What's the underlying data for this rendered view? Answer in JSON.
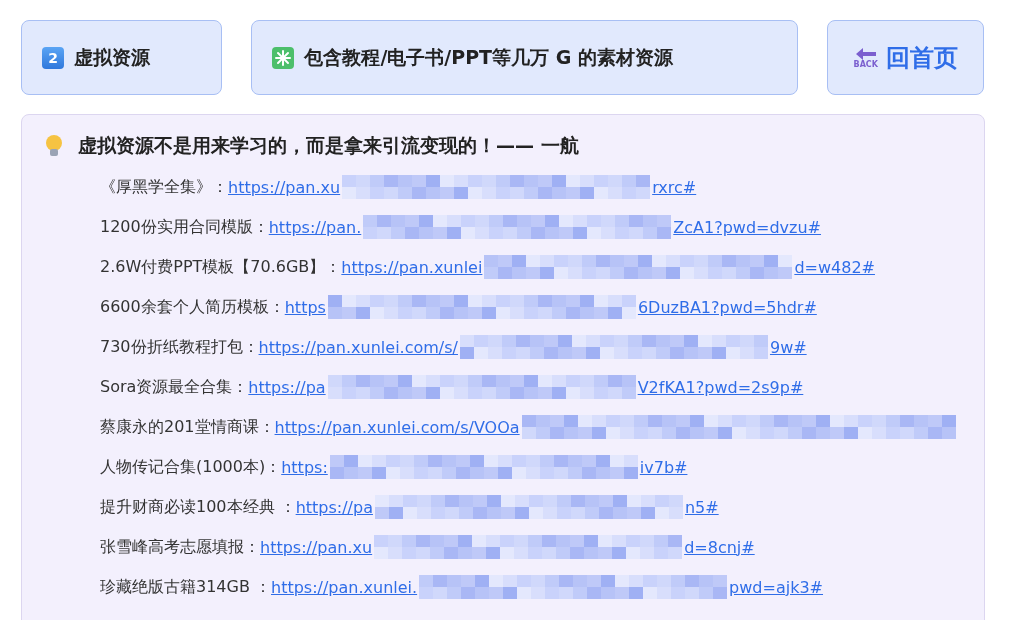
{
  "header_cards": [
    {
      "kind": "number",
      "badge": "2",
      "label": "虚拟资源"
    },
    {
      "kind": "sparkle",
      "label": "包含教程/电子书/PPT等几万 G 的素材资源"
    },
    {
      "kind": "back",
      "badge": "BACK",
      "label": "回首页"
    }
  ],
  "panel": {
    "quote": "虚拟资源不是用来学习的，而是拿来引流变现的！—— 一航",
    "rows": [
      {
        "label": "《厚黑学全集》：",
        "link_start": "https://pan.xu",
        "link_end": "rxrc#"
      },
      {
        "label": "1200份实用合同模版：",
        "link_start": "https://pan.",
        "link_end": "ZcA1?pwd=dvzu#"
      },
      {
        "label": "2.6W付费PPT模板【70.6GB】：",
        "link_start": "https://pan.xunlei",
        "link_end": "d=w482#"
      },
      {
        "label": "6600余套个人简历模板：",
        "link_start": "https",
        "link_end": "6DuzBA1?pwd=5hdr#"
      },
      {
        "label": "730份折纸教程打包：",
        "link_start": "https://pan.xunlei.com/s/",
        "link_end": "9w#"
      },
      {
        "label": "Sora资源最全合集：",
        "link_start": "https://pa",
        "link_end": "V2fKA1?pwd=2s9p#"
      },
      {
        "label": "蔡康永的201堂情商课：",
        "link_start": "https://pan.xunlei.com/s/VOOa"
      },
      {
        "label": "人物传记合集(1000本)：",
        "link_start": "https:",
        "link_end": "iv7b#"
      },
      {
        "label": "提升财商必读100本经典 ：",
        "link_start": "https://pa",
        "link_end": "n5#"
      },
      {
        "label": "张雪峰高考志愿填报：",
        "link_start": "https://pan.xu",
        "link_end": "d=8cnj#"
      },
      {
        "label": "珍藏绝版古籍314GB ：",
        "link_start": "https://pan.xunlei.",
        "link_end": "pwd=ajk3#"
      }
    ]
  }
}
